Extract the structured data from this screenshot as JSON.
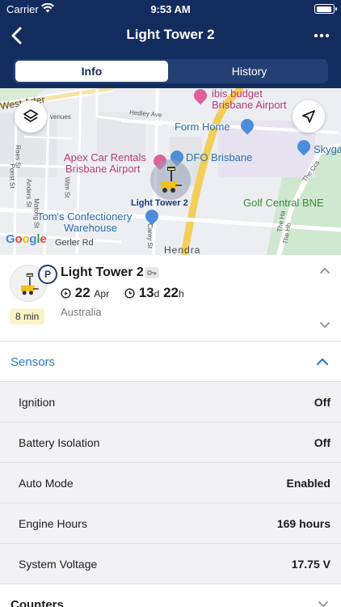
{
  "status_bar": {
    "carrier": "Carrier",
    "time": "9:53 AM"
  },
  "nav": {
    "title": "Light Tower 2",
    "back_icon": "chevron-left-icon",
    "more_icon": "more-dots-icon"
  },
  "tabs": [
    {
      "label": "Info",
      "active": true
    },
    {
      "label": "History",
      "active": false
    }
  ],
  "map": {
    "labels": {
      "west_arterial": "West Arter",
      "ibis_line1": "ibis budget",
      "ibis_line2": "Brisbane Airport",
      "form_home": "Form Home",
      "hedley": "Hedley Ave",
      "skyga": "Skyga",
      "apex_line1": "Apex Car Rentals",
      "apex_line2": "Brisbane Airport",
      "dfo": "DFO Brisbane",
      "golf": "Golf Central BNE",
      "toms_line1": "Tom's Confectionery",
      "toms_line2": "Warehouse",
      "gerler": "Gerler Rd",
      "hendra": "Hendra",
      "the_ccs": "The Ccs",
      "the_ha": "The Ha",
      "the_hb": "The Hb",
      "venues": "venues",
      "ponst": "Ponst St",
      "raes": "Raes St",
      "anders": "Anders St",
      "wim": "Wim St",
      "matong": "Matong St",
      "carey": "Carey St"
    },
    "marker_label": "Light Tower 2",
    "attribution": "Google",
    "layers_icon": "layers-icon",
    "locate_icon": "navigation-arrow-icon"
  },
  "asset": {
    "name": "Light Tower 2",
    "status_badge": "P",
    "age": "8 min",
    "date_day": "22",
    "date_month": "Apr",
    "duration_days": "13",
    "duration_days_unit": "d",
    "duration_hours": "22",
    "duration_hours_unit": "h",
    "location": "Australia"
  },
  "sensors": {
    "title": "Sensors",
    "items": [
      {
        "name": "Ignition",
        "value": "Off"
      },
      {
        "name": "Battery Isolation",
        "value": "Off"
      },
      {
        "name": "Auto Mode",
        "value": "Enabled"
      },
      {
        "name": "Engine Hours",
        "value": "169 hours"
      },
      {
        "name": "System Voltage",
        "value": "17.75 V"
      }
    ]
  },
  "counters": {
    "title": "Counters"
  },
  "colors": {
    "nav_bg": "#132c5e",
    "accent": "#2f78c4",
    "age_badge": "#fbf3c8"
  }
}
